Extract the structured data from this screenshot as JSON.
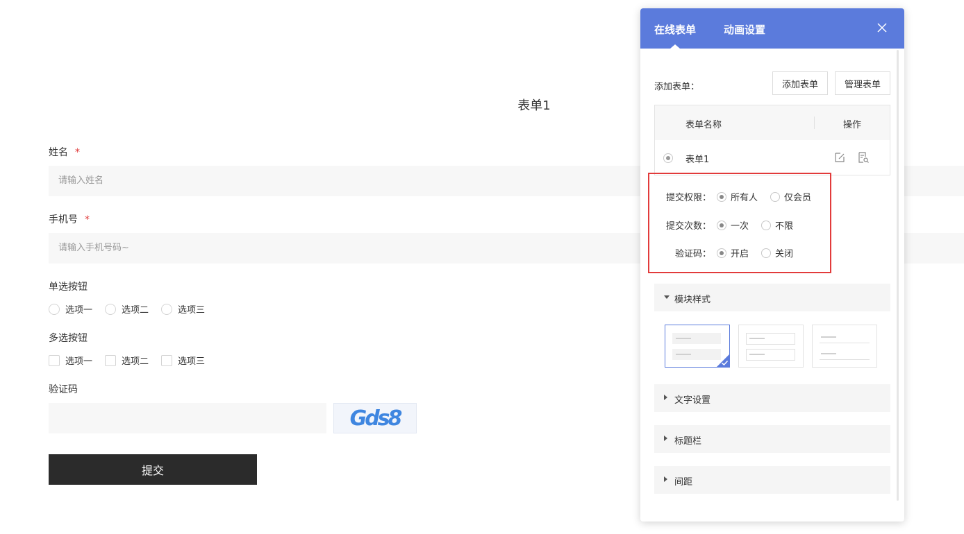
{
  "form": {
    "title": "表单1",
    "name_label": "姓名",
    "required_mark": "*",
    "name_placeholder": "请输入姓名",
    "phone_label": "手机号",
    "phone_placeholder": "请输入手机号码~",
    "radio_label": "单选按钮",
    "radio_options": [
      "选项一",
      "选项二",
      "选项三"
    ],
    "checkbox_label": "多选按钮",
    "checkbox_options": [
      "选项一",
      "选项二",
      "选项三"
    ],
    "captcha_label": "验证码",
    "captcha_text": "Gds8",
    "submit_label": "提交"
  },
  "panel": {
    "tabs": [
      "在线表单",
      "动画设置"
    ],
    "active_tab": 0,
    "header_color": "#5b7bdc",
    "add_form_label": "添加表单：",
    "add_form_button": "添加表单",
    "manage_form_button": "管理表单",
    "table": {
      "col_name": "表单名称",
      "col_action": "操作",
      "rows": [
        {
          "name": "表单1",
          "selected": true
        }
      ]
    },
    "settings": {
      "permission_label": "提交权限：",
      "permission_options": [
        "所有人",
        "仅会员"
      ],
      "permission_selected": 0,
      "count_label": "提交次数：",
      "count_options": [
        "一次",
        "不限"
      ],
      "count_selected": 0,
      "captcha_label": "验证码：",
      "captcha_options": [
        "开启",
        "关闭"
      ],
      "captcha_selected": 0
    },
    "sections": {
      "module_style": "模块样式",
      "text_settings": "文字设置",
      "title_bar": "标题栏",
      "spacing": "间距"
    },
    "highlight_color": "#e23b3b"
  }
}
